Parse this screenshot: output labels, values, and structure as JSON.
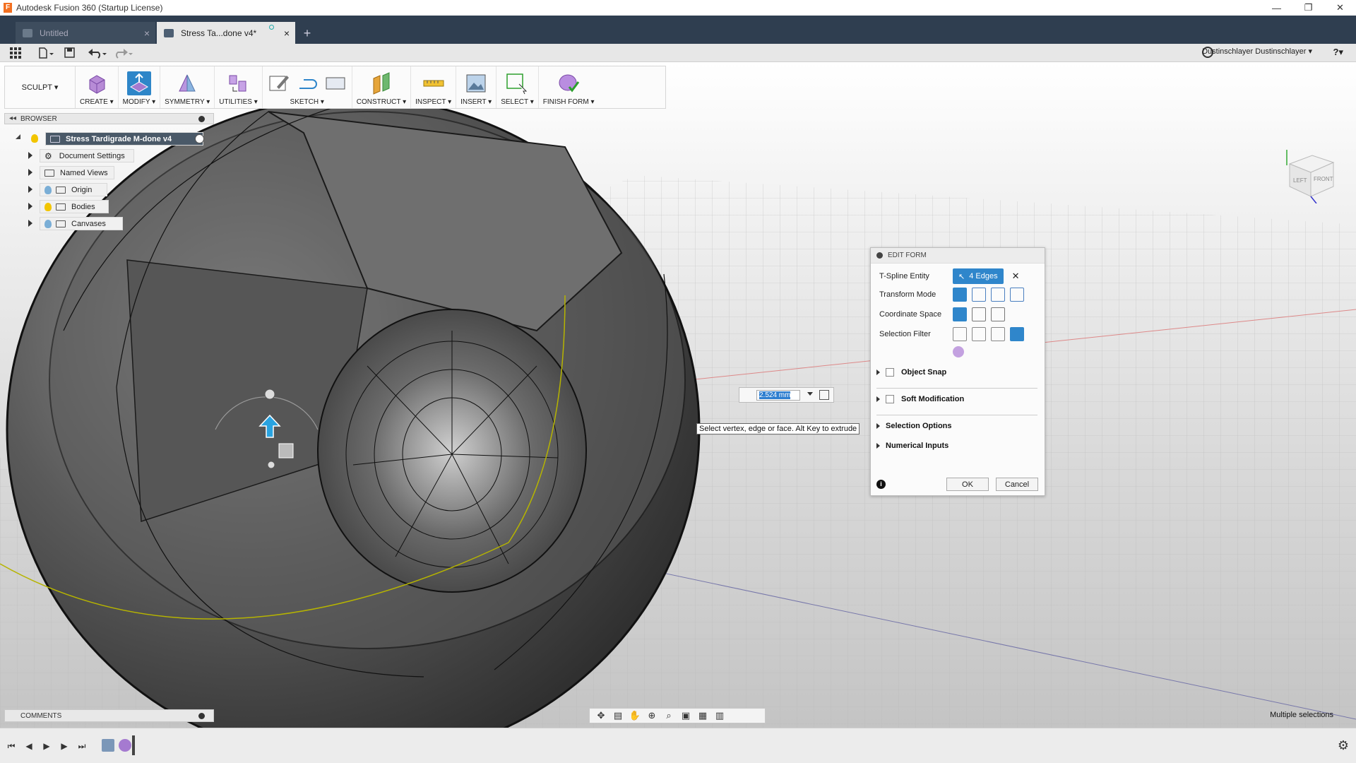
{
  "window": {
    "title": "Autodesk Fusion 360 (Startup License)",
    "logo_letter": "F",
    "minimize_glyph": "—",
    "restore_glyph": "❐",
    "close_glyph": "✕"
  },
  "tabs": [
    {
      "label": "Untitled",
      "active": false
    },
    {
      "label": "Stress Ta...done v4*",
      "active": true
    }
  ],
  "new_tab_glyph": "+",
  "quick_access": {
    "user": "Dustinschlayer Dustinschlayer ▾",
    "help": "?▾"
  },
  "toolbar": {
    "workspace": "SCULPT ▾",
    "groups": [
      {
        "label": "CREATE ▾"
      },
      {
        "label": "MODIFY ▾"
      },
      {
        "label": "SYMMETRY ▾"
      },
      {
        "label": "UTILITIES ▾"
      },
      {
        "label": "SKETCH ▾"
      },
      {
        "label": "CONSTRUCT ▾"
      },
      {
        "label": "INSPECT ▾"
      },
      {
        "label": "INSERT ▾"
      },
      {
        "label": "SELECT ▾"
      },
      {
        "label": "FINISH FORM ▾"
      }
    ]
  },
  "browser": {
    "title": "BROWSER",
    "root": "Stress Tardigrade M-done v4",
    "items": [
      {
        "label": "Document Settings"
      },
      {
        "label": "Named Views"
      },
      {
        "label": "Origin"
      },
      {
        "label": "Bodies"
      },
      {
        "label": "Canvases"
      }
    ]
  },
  "edit_form": {
    "title": "EDIT FORM",
    "tspline_label": "T-Spline Entity",
    "tspline_value": "4 Edges",
    "transform_label": "Transform Mode",
    "coord_label": "Coordinate Space",
    "filter_label": "Selection Filter",
    "object_snap": "Object Snap",
    "soft_mod": "Soft Modification",
    "selection_options": "Selection Options",
    "numerical_inputs": "Numerical Inputs",
    "ok": "OK",
    "cancel": "Cancel",
    "clear_glyph": "✕",
    "info_glyph": "i"
  },
  "value_input": {
    "value": "2.524 mm"
  },
  "hint": "Select vertex, edge or face. Alt Key to extrude",
  "view_cube": {
    "left": "LEFT",
    "front": "FRONT"
  },
  "comments": {
    "title": "COMMENTS"
  },
  "status": "Multiple selections",
  "colors": {
    "accent": "#2f86cb",
    "tabbar": "#2f3e50",
    "bulb_on": "#f2c500",
    "bulb_off": "#7aaed6"
  }
}
